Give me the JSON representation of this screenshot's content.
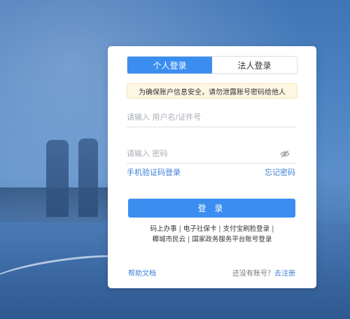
{
  "tabs": [
    {
      "label": "个人登录",
      "active": true
    },
    {
      "label": "法人登录",
      "active": false
    }
  ],
  "notice": "为确保账户信息安全，请勿泄露账号密码给他人",
  "username": {
    "placeholder": "请输入 用户名/证件号",
    "value": ""
  },
  "password": {
    "placeholder": "请输入 密码",
    "value": ""
  },
  "links": {
    "sms_login": "手机验证码登录",
    "forgot": "忘记密码"
  },
  "login_button": "登 录",
  "alt_logins": [
    "码上办事",
    "电子社保卡",
    "支付宝刷脸登录",
    "椰城市民云",
    "国家政务服务平台账号登录"
  ],
  "footer": {
    "help": "帮助文档",
    "no_account": "还没有账号？",
    "register": "去注册"
  },
  "colors": {
    "primary": "#3b8ef0",
    "link": "#3b7fd6",
    "notice_bg": "#fdf6e3"
  }
}
